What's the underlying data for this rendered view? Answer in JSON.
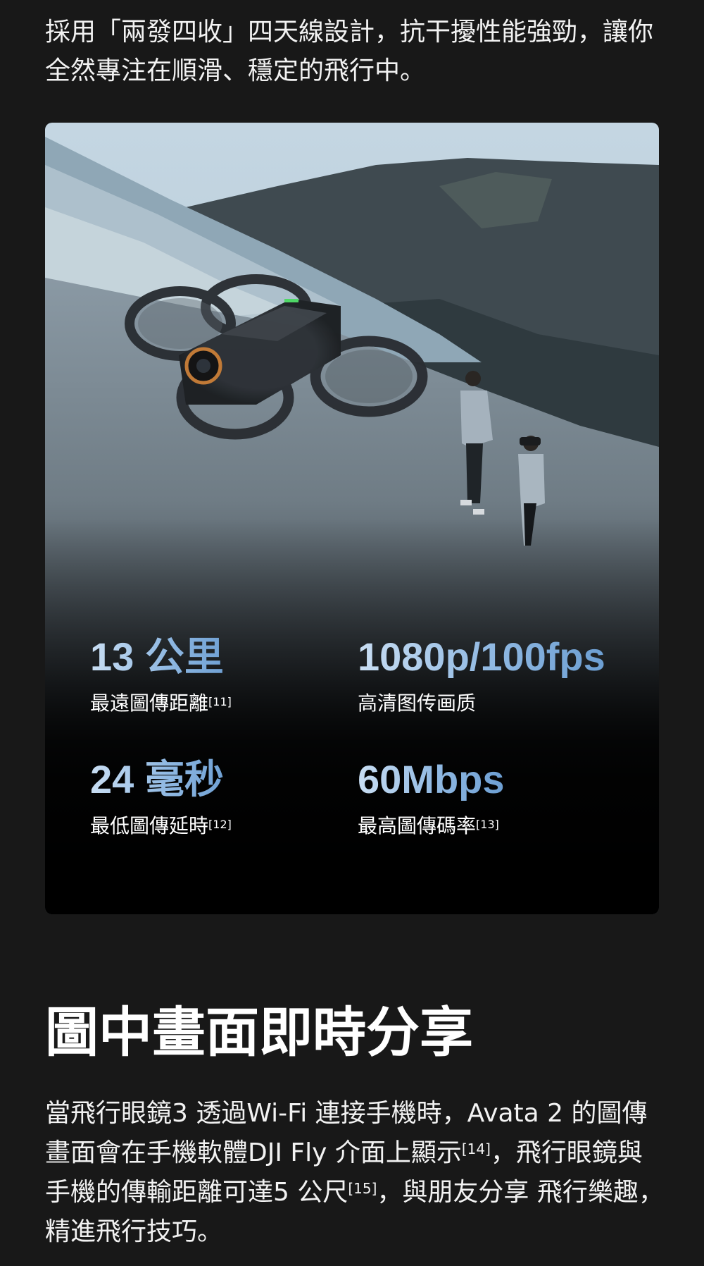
{
  "intro": {
    "text": "採用「兩發四收」四天線設計，抗干擾性能強勁，讓你全然專注在順滑、穩定的飛行中。"
  },
  "stats": [
    {
      "value": "13 公里",
      "label": "最遠圖傳距離",
      "note": "[11]"
    },
    {
      "value": "1080p/100fps",
      "label": "高清图传画质",
      "note": ""
    },
    {
      "value": "24 毫秒",
      "label": "最低圖傳延時",
      "note": "[12]"
    },
    {
      "value": "60Mbps",
      "label": "最高圖傳碼率",
      "note": "[13]"
    }
  ],
  "section": {
    "title": "圖中畫面即時分享",
    "body_1": "當飛行眼鏡3 透過Wi-Fi 連接手機時，Avata 2 的圖傳畫面會在手機軟體DJI Fly 介面上顯示",
    "note_1": "[14]",
    "body_2": "，飛行眼鏡與手機的傳輸距離可達5 公尺",
    "note_2": "[15]",
    "body_3": "，與朋友分享 飛行樂趣，精進飛行技巧。"
  },
  "colors": {
    "page_background": "#181818",
    "stat_value_gradient": [
      "#c9def3",
      "#6c9ed2"
    ]
  }
}
